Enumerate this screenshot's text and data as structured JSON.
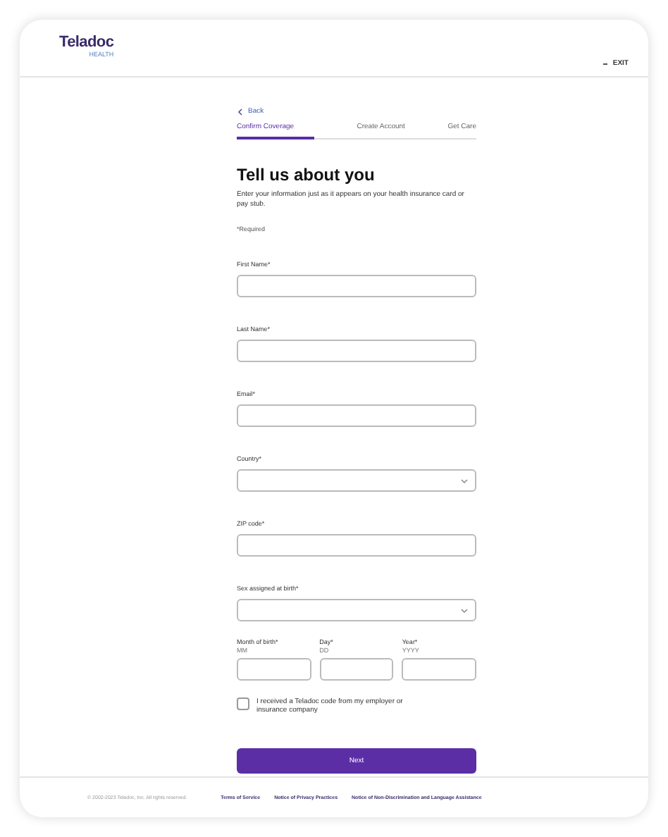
{
  "header": {
    "logo": "Teladoc",
    "logo_sub": "HEALTH",
    "exit": "EXIT"
  },
  "back": "Back",
  "steps": [
    {
      "label": "Confirm Coverage",
      "selected": true
    },
    {
      "label": "Create Account",
      "selected": false
    },
    {
      "label": "Get Care",
      "selected": false
    }
  ],
  "title": "Tell us about you",
  "description": "Enter your information just as it appears on your health insurance card or pay stub.",
  "required_note": "*Required",
  "fields": [
    {
      "kind": "text",
      "label": "First Name*"
    },
    {
      "kind": "text",
      "label": "Last Name*"
    },
    {
      "kind": "text",
      "label": "Email*"
    },
    {
      "kind": "select",
      "label": "Country*"
    },
    {
      "kind": "text",
      "label": "ZIP code*"
    },
    {
      "kind": "select",
      "label": "Sex assigned at birth*"
    }
  ],
  "date_fields": [
    {
      "label": "Month of birth*",
      "hint": "MM"
    },
    {
      "label": "Day*",
      "hint": "DD"
    },
    {
      "label": "Year*",
      "hint": "YYYY"
    }
  ],
  "code_checkbox": {
    "label": "I received a Teladoc code from my employer or insurance company",
    "checked": false
  },
  "next_button": "Next",
  "footer": {
    "copyright": "© 2002-2023 Teladoc, Inc. All rights reserved.",
    "links": [
      "Terms of Service",
      "Notice of Privacy Practices",
      "Notice of Non-Discrimination and Language Assistance"
    ]
  }
}
